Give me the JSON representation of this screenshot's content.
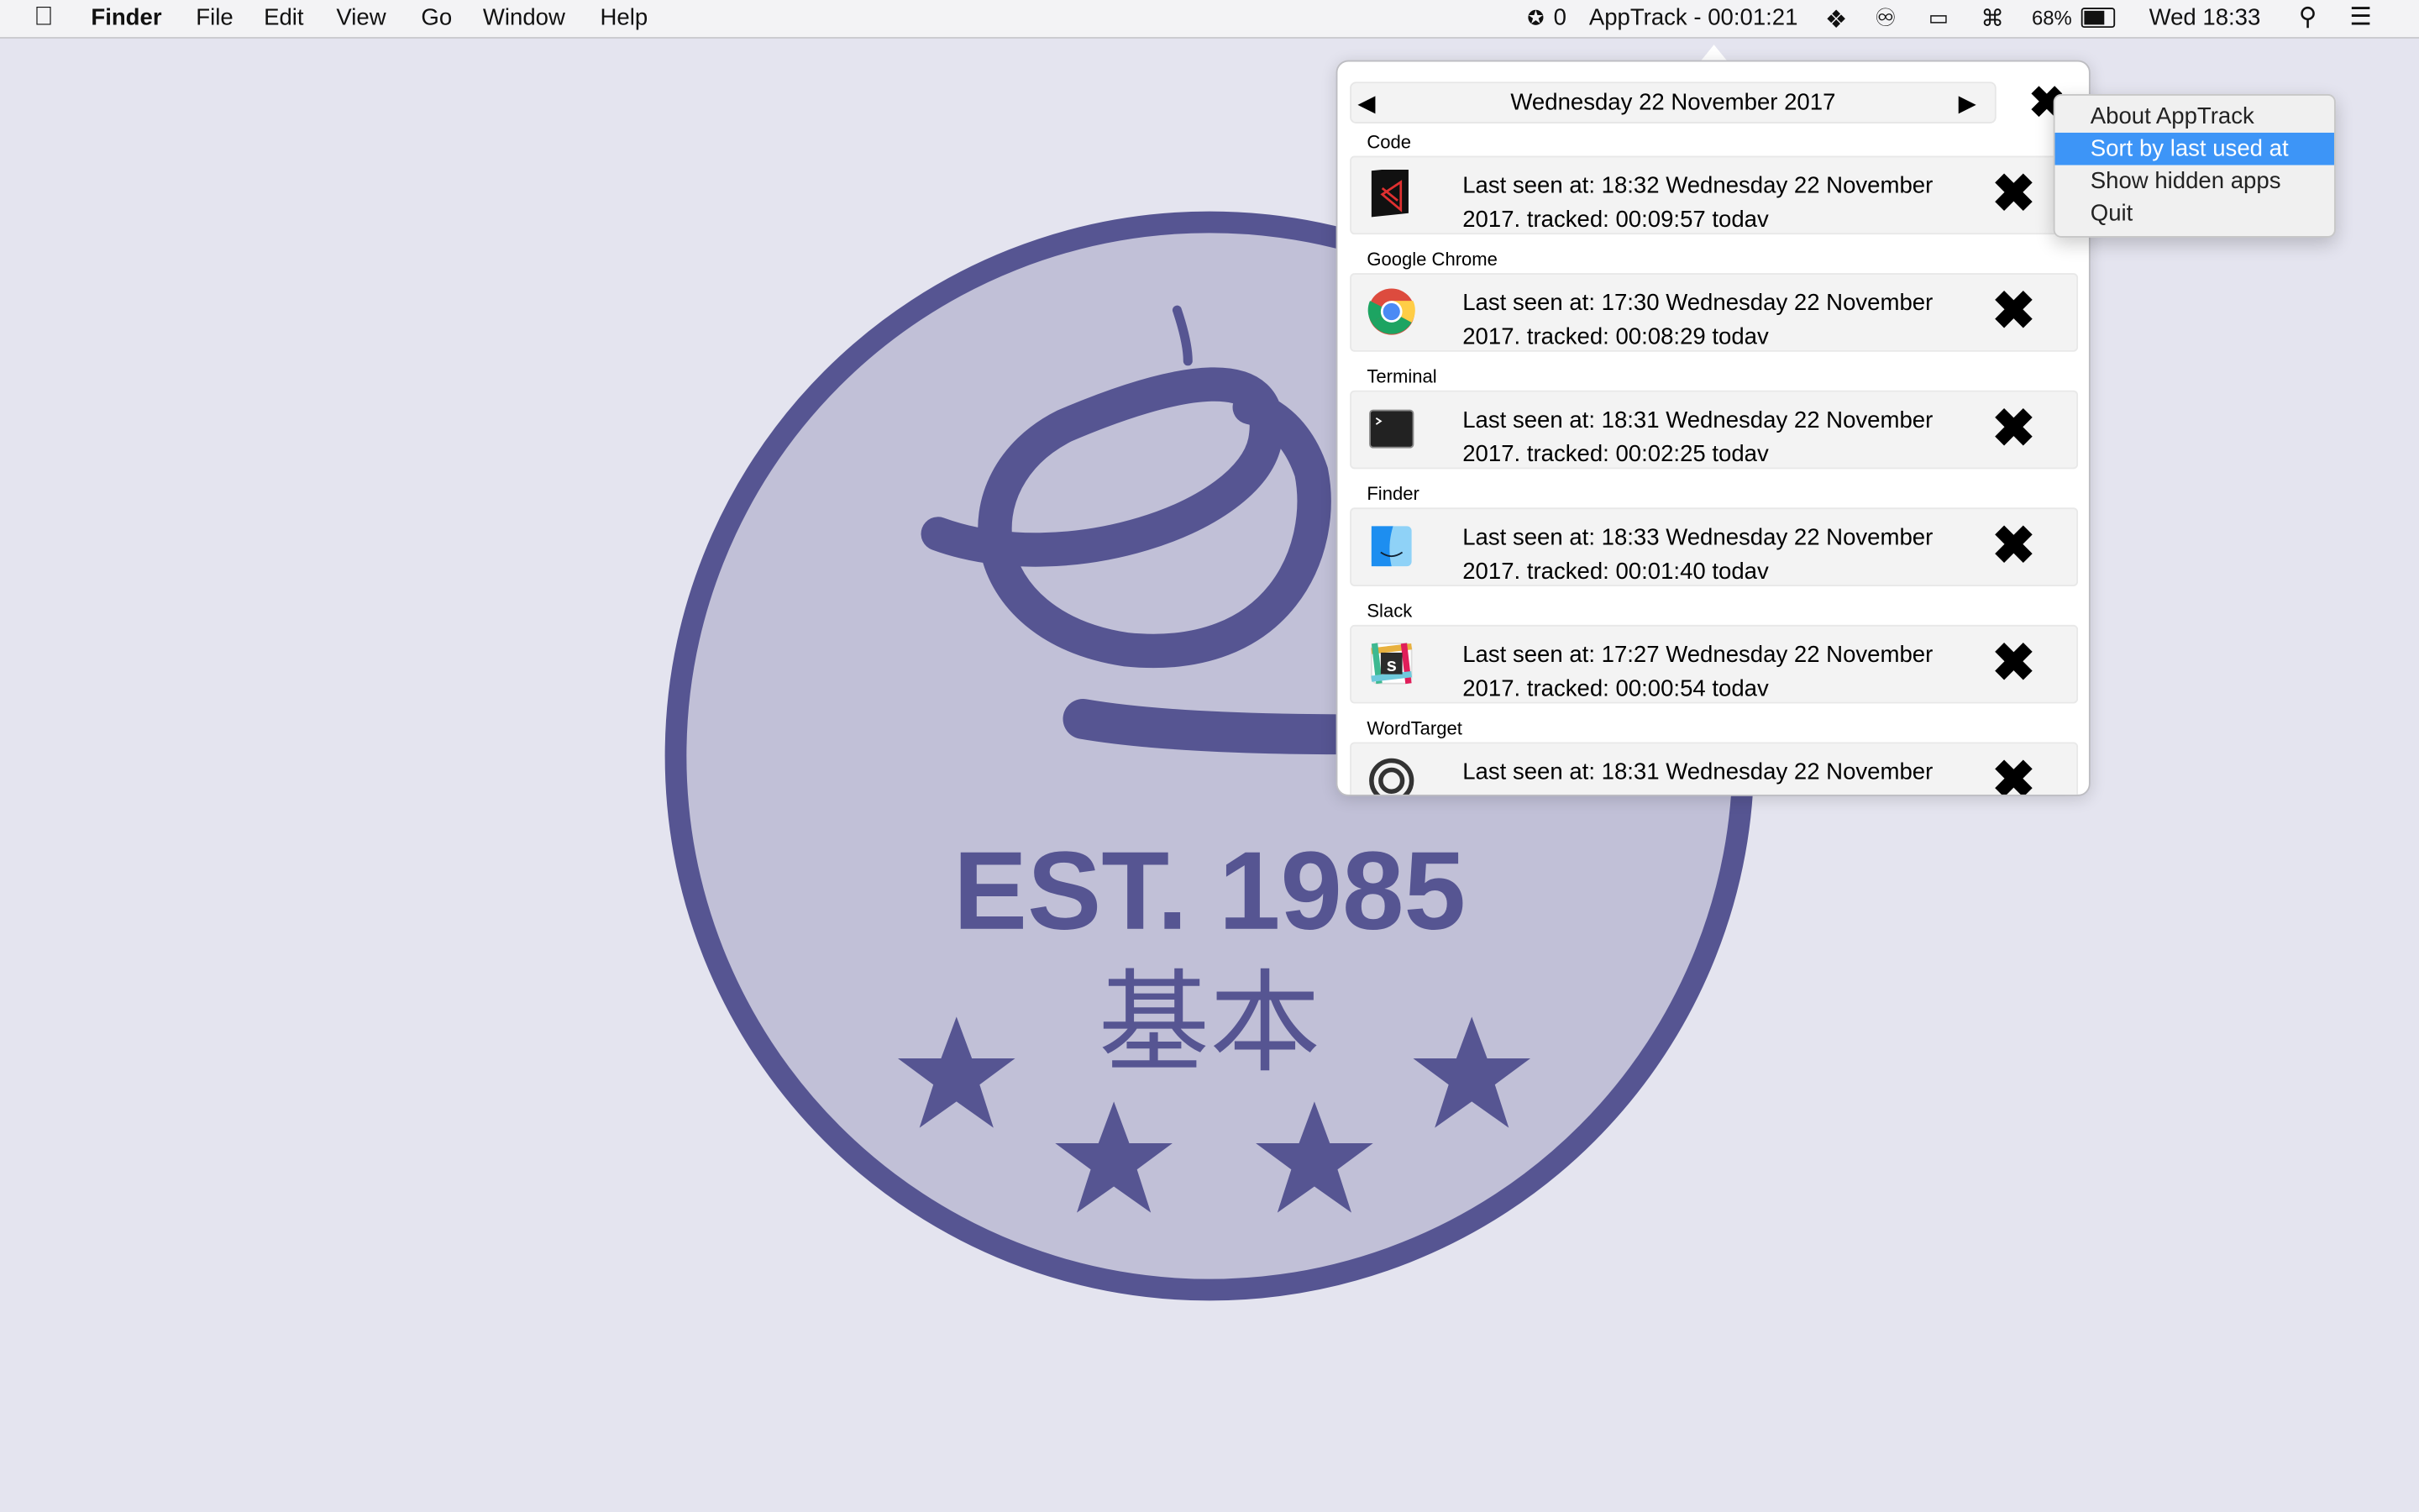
{
  "menubar": {
    "app_name": "Finder",
    "menus": [
      "File",
      "Edit",
      "View",
      "Go",
      "Window",
      "Help"
    ],
    "status_count": "0",
    "apptrack": "AppTrack - 00:01:21",
    "battery": "68%",
    "clock": "Wed 18:33",
    "icons": [
      "apple-icon",
      "status-star-icon",
      "dropbox-icon",
      "creative-cloud-icon",
      "airplay-icon",
      "wifi-icon",
      "battery-icon",
      "spotlight-icon",
      "notification-center-icon"
    ]
  },
  "logo": {
    "est": "EST. 1985",
    "kanji": "基本",
    "color": "#565592",
    "fill": "#c1c0d7"
  },
  "popover": {
    "date": "Wednesday 22 November 2017",
    "apps": [
      {
        "name": "Code",
        "line1": "Last seen at: 18:32 Wednesday 22 November",
        "line2": "2017. tracked: 00:09:57 todav"
      },
      {
        "name": "Google Chrome",
        "line1": "Last seen at: 17:30 Wednesday 22 November",
        "line2": "2017. tracked: 00:08:29 todav"
      },
      {
        "name": "Terminal",
        "line1": "Last seen at: 18:31 Wednesday 22 November",
        "line2": "2017. tracked: 00:02:25 todav"
      },
      {
        "name": "Finder",
        "line1": "Last seen at: 18:33 Wednesday 22 November",
        "line2": "2017. tracked: 00:01:40 todav"
      },
      {
        "name": "Slack",
        "line1": "Last seen at: 17:27 Wednesday 22 November",
        "line2": "2017. tracked: 00:00:54 todav"
      },
      {
        "name": "WordTarget",
        "line1": "Last seen at: 18:31 Wednesday 22 November",
        "line2": ""
      }
    ]
  },
  "context_menu": {
    "items": [
      "About AppTrack",
      "Sort by last used at",
      "Show hidden apps",
      "Quit"
    ],
    "selected": "Sort by last used at",
    "highlight": "#3d95f7"
  }
}
